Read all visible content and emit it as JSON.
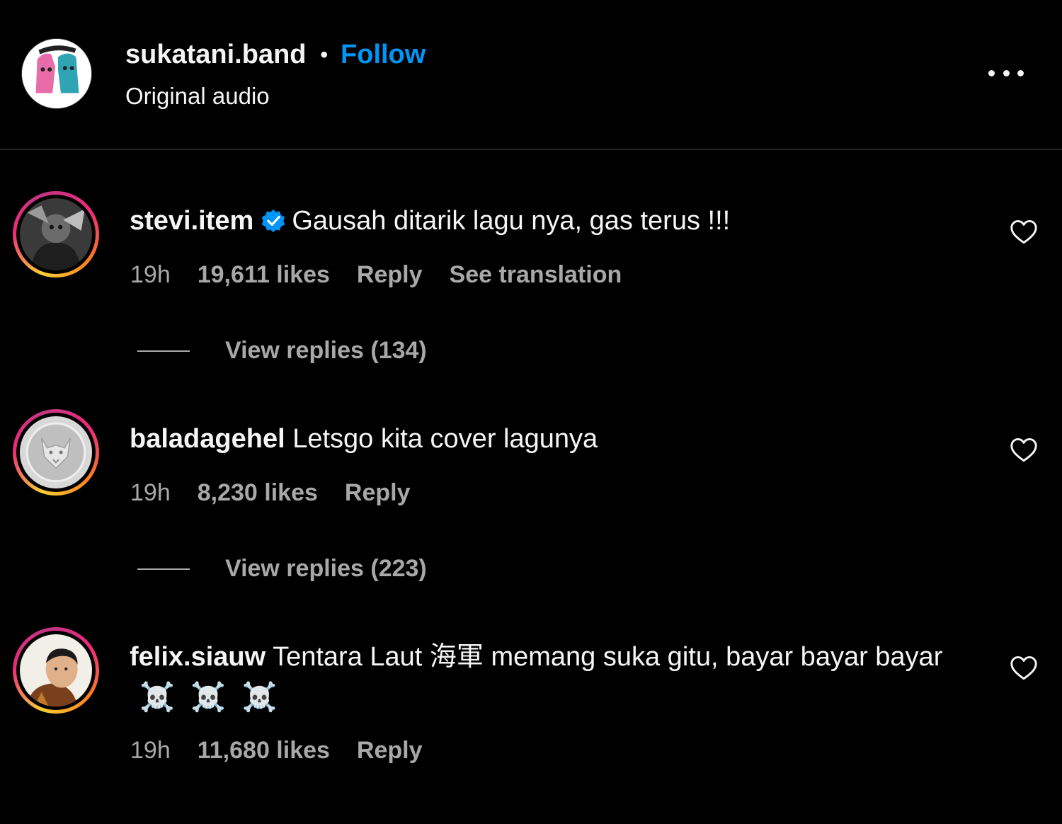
{
  "post": {
    "username": "sukatani.band",
    "separator": "•",
    "follow_label": "Follow",
    "audio_label": "Original audio",
    "more_icon": "more-horizontal-icon"
  },
  "comments": [
    {
      "username": "stevi.item",
      "verified": true,
      "text": "Gausah ditarik lagu nya, gas terus !!!",
      "time": "19h",
      "likes": "19,611 likes",
      "reply_label": "Reply",
      "translation_label": "See translation",
      "view_replies": "View replies (134)"
    },
    {
      "username": "baladagehel",
      "verified": false,
      "text": "Letsgo kita cover lagunya",
      "time": "19h",
      "likes": "8,230 likes",
      "reply_label": "Reply",
      "view_replies": "View replies (223)"
    },
    {
      "username": "felix.siauw",
      "verified": false,
      "text": "Tentara Laut 海軍 memang suka gitu, bayar bayar bayar",
      "emoji": [
        "☠️",
        "☠️",
        "☠️"
      ],
      "time": "19h",
      "likes": "11,680 likes",
      "reply_label": "Reply"
    }
  ],
  "colors": {
    "background": "#000000",
    "follow": "#0095f6",
    "meta_text": "#a8a8a8",
    "verified": "#0095f6"
  }
}
